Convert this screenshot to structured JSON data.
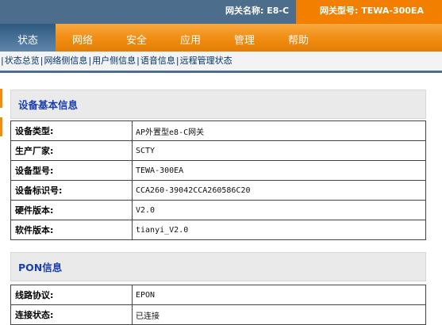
{
  "header": {
    "gateway_name": "网关名称:  E8-C",
    "gateway_model": "网关型号: TEWA-300EA"
  },
  "tabs": [
    {
      "label": "状态",
      "active": true
    },
    {
      "label": "网络",
      "active": false
    },
    {
      "label": "安全",
      "active": false
    },
    {
      "label": "应用",
      "active": false
    },
    {
      "label": "管理",
      "active": false
    },
    {
      "label": "帮助",
      "active": false
    }
  ],
  "subnav": [
    "状态总览",
    "网络侧信息",
    "用户侧信息",
    "语音信息",
    "远程管理状态"
  ],
  "sections": [
    {
      "title": "设备基本信息",
      "rows": [
        {
          "label": "设备类型:",
          "value": "AP外置型e8-C网关"
        },
        {
          "label": "生产厂家:",
          "value": "SCTY"
        },
        {
          "label": "设备型号:",
          "value": "TEWA-300EA"
        },
        {
          "label": "设备标识号:",
          "value": "CCA260-39042CCA260586C20"
        },
        {
          "label": "硬件版本:",
          "value": "V2.0"
        },
        {
          "label": "软件版本:",
          "value": "tianyi_V2.0"
        }
      ]
    },
    {
      "title": "PON信息",
      "rows": [
        {
          "label": "线路协议:",
          "value": "EPON"
        },
        {
          "label": "连接状态:",
          "value": "已连接"
        }
      ]
    }
  ],
  "colors": {
    "topbar": "#4d6d8d",
    "accent_orange": "#f08c10",
    "section_title": "#1b3fb0"
  }
}
